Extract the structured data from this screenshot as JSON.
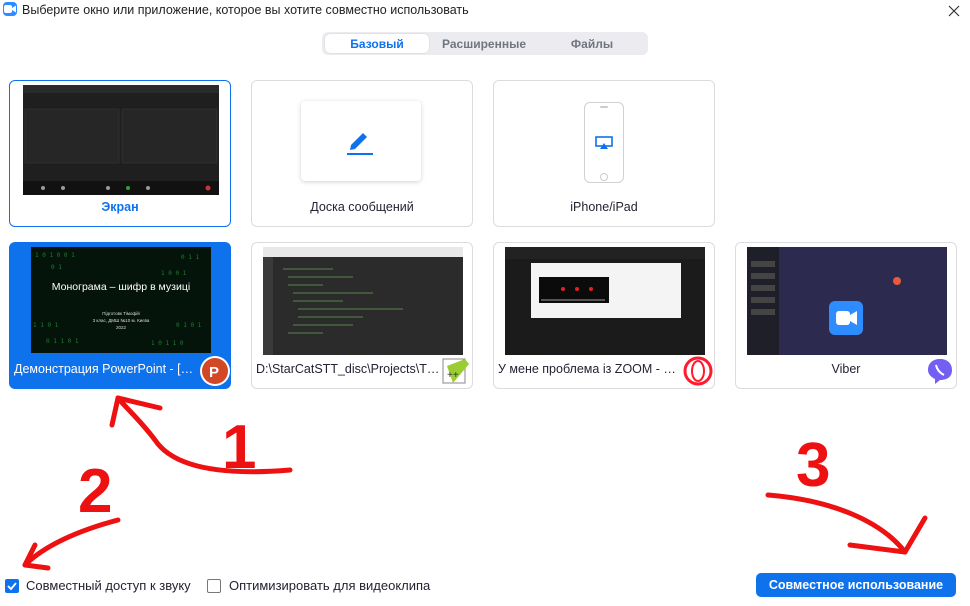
{
  "window": {
    "title": "Выберите окно или приложение, которое вы хотите совместно использовать",
    "app_icon": "zoom-camera-icon",
    "close_icon": "close-icon"
  },
  "tabs": [
    {
      "label": "Базовый",
      "active": true
    },
    {
      "label": "Расширенные",
      "active": false
    },
    {
      "label": "Файлы",
      "active": false
    }
  ],
  "cards": [
    {
      "label": "Экран",
      "selected": "outline"
    },
    {
      "label": "Доска сообщений",
      "icon": "pen-icon"
    },
    {
      "label": "iPhone/iPad",
      "icon": "airplay-icon"
    },
    {
      "label": "Демонстрация PowerPoint - [Ш...",
      "selected": "fill",
      "badge": "powerpoint-icon",
      "slide": {
        "title": "Монограма – шифр в музиці",
        "line1": "Підготовк Тімофій",
        "line2": "3 клас, ДМШ №10 м. Києва",
        "line3": "2022"
      }
    },
    {
      "label": "D:\\StarCatSTT_disc\\Projects\\TheL...",
      "badge": "notepad-plus-plus-icon"
    },
    {
      "label": "У мене проблема із ZOOM - Op...",
      "badge": "opera-icon"
    },
    {
      "label": "Viber",
      "badge": "viber-icon"
    }
  ],
  "options": {
    "share_audio": {
      "label": "Совместный доступ к звуку",
      "checked": true
    },
    "optimize_video": {
      "label": "Оптимизировать для видеоклипа",
      "checked": false
    }
  },
  "share_button": {
    "label": "Совместное использование"
  },
  "annotations": [
    "1",
    "2",
    "3"
  ],
  "colors": {
    "accent": "#0e72ed",
    "annotation": "#ee1111"
  }
}
